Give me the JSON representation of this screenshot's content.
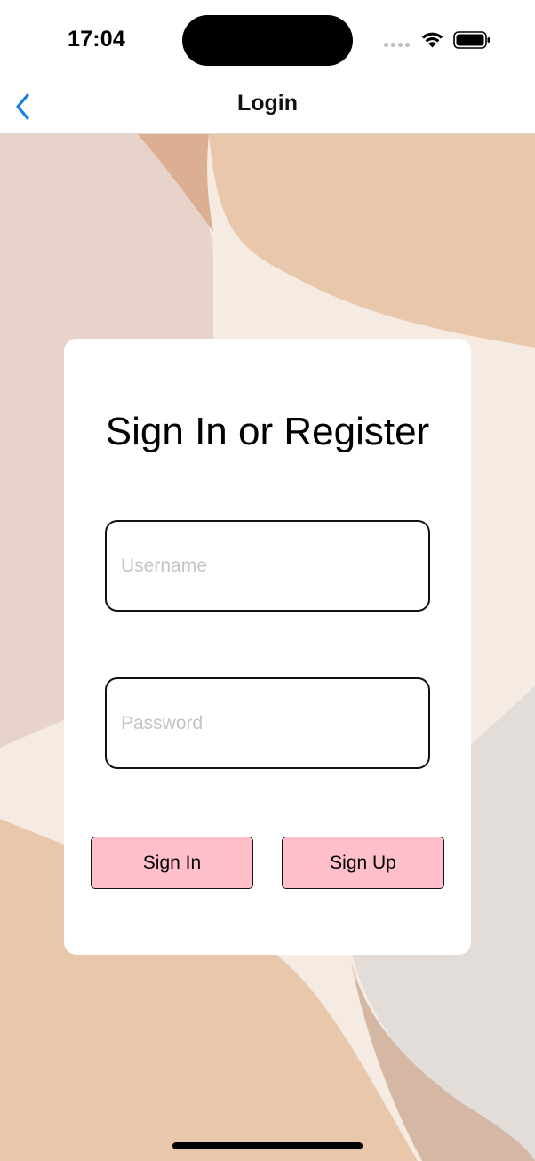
{
  "status_bar": {
    "time": "17:04",
    "icons": [
      "cellular-dots-icon",
      "wifi-icon",
      "battery-icon"
    ]
  },
  "nav": {
    "title": "Login",
    "back_icon": "chevron-left-icon",
    "accent_color": "#1a7ee6"
  },
  "card": {
    "title": "Sign In or Register",
    "username": {
      "value": "",
      "placeholder": "Username"
    },
    "password": {
      "value": "",
      "placeholder": "Password"
    },
    "sign_in_label": "Sign In",
    "sign_up_label": "Sign Up",
    "button_color": "#ffc0cb"
  },
  "background": {
    "colors": [
      "#e8d3cb",
      "#f6ebe3",
      "#e8c7aa",
      "#dcae92",
      "#e2ddd9",
      "#d5b8a4"
    ]
  }
}
